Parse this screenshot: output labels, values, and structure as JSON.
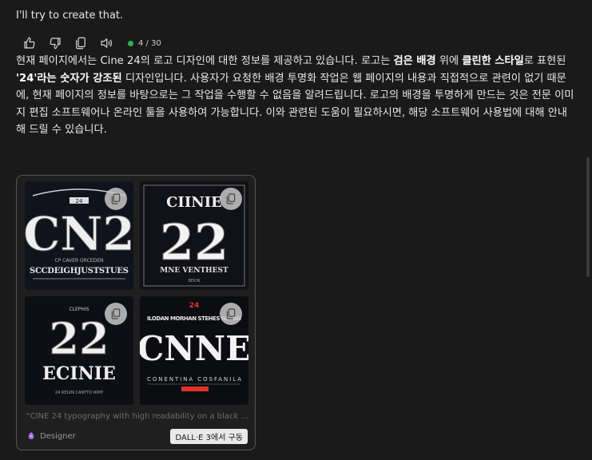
{
  "intro": "I'll try to create that.",
  "actions": {
    "status_count": "4 / 30"
  },
  "message": {
    "p1": "현재 페이지에서는 Cine 24의 로고 디자인에 대한 정보를 제공하고 있습니다. 로고는 ",
    "b1": "검은 배경",
    "p2": " 위에 ",
    "b2": "클린한 스타일",
    "p3": "로 표현된 ",
    "b3": "'24'라는 숫자가 강조된",
    "p4": " 디자인입니다. 사용자가 요청한 배경 투명화 작업은 웹 페이지의 내용과 직접적으로 관련이 없기 때문에, 현재 페이지의 정보를 바탕으로는 그 작업을 수행할 수 없음을 알려드립니다. 로고의 배경을 투명하게 만드는 것은 전문 이미지 편집 소프트웨어나 온라인 툴을 사용하여 가능합니다. 이와 관련된 도움이 필요하시면, 해당 소프트웨어 사용법에 대해 안내해 드릴 수 있습니다."
  },
  "card": {
    "images": [
      {
        "big": "CN2",
        "top": "24",
        "bottom": "SCCDEIGHJUSTSTUES",
        "sub": "CP CAVER ORCEDEN"
      },
      {
        "big": "22",
        "top": "CIINIE",
        "bottom": "MNE VENTHEST",
        "sub": "BEKIN"
      },
      {
        "big": "22",
        "top": "CLEPHIS",
        "bottom": "ECINIE",
        "sub": "24 RELVN CANTTO WIPP"
      },
      {
        "big": "CNNE",
        "top": "24",
        "bottom": "CONENTINA COSFANILA",
        "sub": "ILODAN MORHAN STEHES NEVAN"
      }
    ],
    "prompt": "\"CINE 24 typography with high readability on a black ...\"",
    "brand": "Designer",
    "powered_by": "DALL·E 3에서 구동"
  },
  "colors": {
    "background": "#1a1a1a",
    "accent_red": "#e0342a",
    "status_green": "#2fb34a"
  }
}
